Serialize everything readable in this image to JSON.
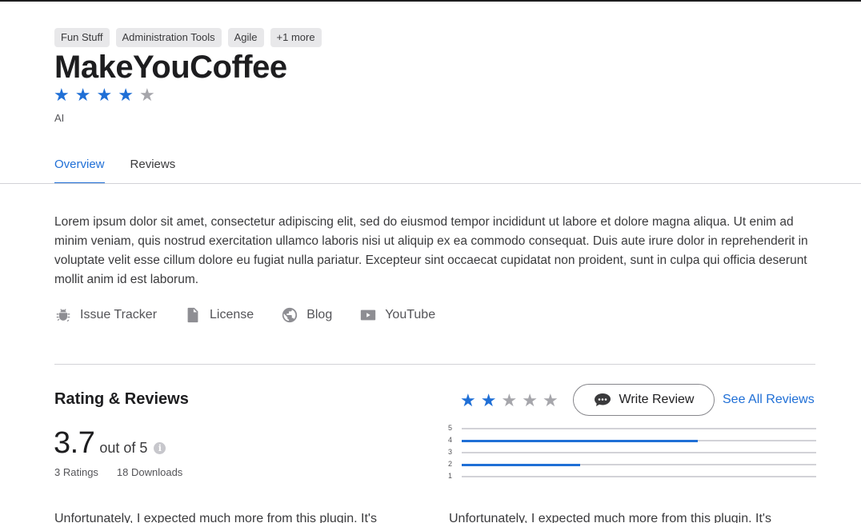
{
  "tags": [
    "Fun Stuff",
    "Administration Tools",
    "Agile",
    "+1 more"
  ],
  "app": {
    "title": "MakeYouCoffee",
    "rating_stars": 4,
    "max_stars": 5,
    "author": "AI"
  },
  "tabs": [
    {
      "label": "Overview",
      "active": true
    },
    {
      "label": "Reviews",
      "active": false
    }
  ],
  "description": "Lorem ipsum dolor sit amet, consectetur adipiscing elit, sed do eiusmod tempor incididunt ut labore et dolore magna aliqua. Ut enim ad minim veniam, quis nostrud exercitation ullamco laboris nisi ut aliquip ex ea commodo consequat. Duis aute irure dolor in reprehenderit in voluptate velit esse cillum dolore eu fugiat nulla pariatur. Excepteur sint occaecat cupidatat non proident, sunt in culpa qui officia deserunt mollit anim id est laborum.",
  "links": [
    {
      "label": "Issue Tracker",
      "icon": "bug-icon"
    },
    {
      "label": "License",
      "icon": "document-icon"
    },
    {
      "label": "Blog",
      "icon": "globe-icon"
    },
    {
      "label": "YouTube",
      "icon": "youtube-icon"
    }
  ],
  "ratings": {
    "section_title": "Rating & Reviews",
    "score": "3.7",
    "out_of": "out of 5",
    "ratings_count": "3 Ratings",
    "downloads": "18 Downloads",
    "user_stars_filled": 2,
    "write_review_label": "Write Review",
    "see_all_label": "See All Reviews",
    "histogram": [
      {
        "label": "5",
        "fraction": 0
      },
      {
        "label": "4",
        "fraction": 0.667
      },
      {
        "label": "3",
        "fraction": 0
      },
      {
        "label": "2",
        "fraction": 0.333
      },
      {
        "label": "1",
        "fraction": 0
      }
    ]
  },
  "reviews": [
    {
      "snippet": "Unfortunately, I expected much more from this plugin. It's"
    },
    {
      "snippet": "Unfortunately, I expected much more from this plugin. It's"
    }
  ],
  "colors": {
    "accent": "#1f6fd6",
    "star_empty": "#a6a6ab"
  }
}
